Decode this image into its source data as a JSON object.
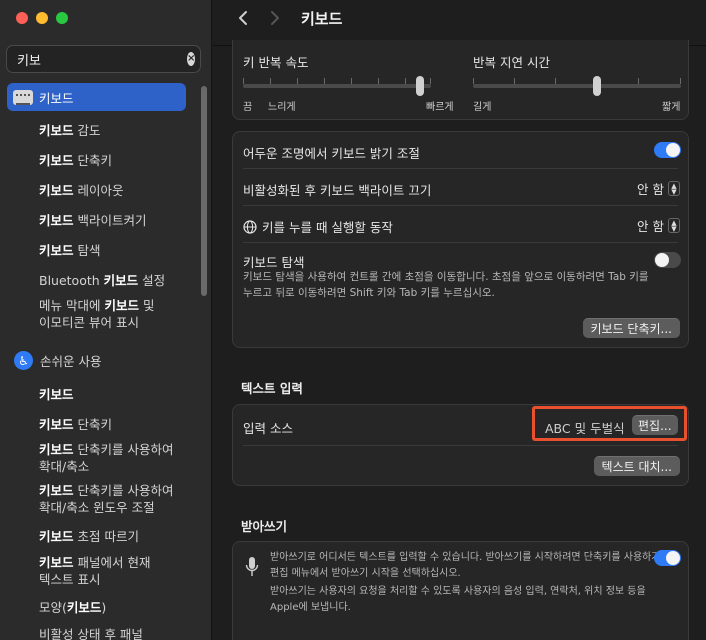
{
  "window": {
    "title": "키보드"
  },
  "search": {
    "value": "키보"
  },
  "sidebar": {
    "selected": "키보드",
    "items": [
      {
        "pre": "",
        "bold": "키보드",
        "post": " 감도"
      },
      {
        "pre": "",
        "bold": "키보드",
        "post": " 단축키"
      },
      {
        "pre": "",
        "bold": "키보드",
        "post": " 레이아웃"
      },
      {
        "pre": "",
        "bold": "키보드",
        "post": " 백라이트켜기"
      },
      {
        "pre": "",
        "bold": "키보드",
        "post": " 탐색"
      },
      {
        "pre": "Bluetooth ",
        "bold": "키보드",
        "post": " 설정"
      },
      {
        "pre": "메뉴 막대에 ",
        "bold": "키보드",
        "post": " 및"
      }
    ],
    "menu_line2": "이모티콘 뷰어 표시",
    "accessibility": {
      "header": "손쉬운 사용",
      "items": [
        {
          "bold": "키보드",
          "post": ""
        },
        {
          "bold": "키보드",
          "post": " 단축키"
        },
        {
          "bold": "키보드",
          "post": " 단축키를 사용하여",
          "line2": "확대/축소"
        },
        {
          "bold": "키보드",
          "post": " 단축키를 사용하여",
          "line2": "확대/축소 윈도우 조절"
        },
        {
          "bold": "키보드",
          "post": " 초점 따르기"
        },
        {
          "bold": "키보드",
          "post": " 패널에서 현재",
          "line2": "텍스트 표시"
        },
        {
          "pre": "모양(",
          "bold": "키보드",
          "post": ")"
        },
        {
          "pre": "비활성 상태 후 패널",
          "bold": "",
          "post": ""
        }
      ]
    }
  },
  "repeat": {
    "speed_label": "키 반복 속도",
    "speed_min": "끔",
    "speed_slow": "느리게",
    "speed_fast": "빠르게",
    "speed_value": 0.92,
    "delay_label": "반복 지연 시간",
    "delay_long": "길게",
    "delay_short": "짧게",
    "delay_value": 0.6
  },
  "backlight": {
    "adjust_label": "어두운 조명에서 키보드 밝기 조절",
    "adjust_on": true,
    "off_label": "비활성화된 후 키보드 백라이트 끄기",
    "off_value": "안 함",
    "globe_label": "키를 누를 때 실행할 동작",
    "globe_value": "안 함",
    "nav_label": "키보드 탐색",
    "nav_desc_1": "키보드 탐색을 사용하여 컨트롤 간에 초점을 이동합니다. 초점을 앞으로 이동하려면 Tab 키를",
    "nav_desc_2": "누르고 뒤로 이동하려면 Shift 키와 Tab 키를 누르십시오.",
    "nav_on": false,
    "shortcuts_button": "키보드 단축키..."
  },
  "text_input": {
    "section": "텍스트 입력",
    "source_label": "입력 소스",
    "source_value": "ABC 및 두벌식",
    "edit_button": "편집...",
    "replace_button": "텍스트 대치..."
  },
  "dictation": {
    "section": "받아쓰기",
    "desc_1": "받아쓰기로 어디서든 텍스트를 입력할 수 있습니다. 받아쓰기를 시작하려면 단축키를 사용하거나",
    "desc_2": "편집 메뉴에서 받아쓰기 시작을 선택하십시오.",
    "desc_3": "받아쓰기는 사용자의 요청을 처리할 수 있도록 사용자의 음성 입력, 연락처, 위치 정보 등을",
    "desc_4": "Apple에 보냅니다.",
    "on": true
  },
  "colors": {
    "accent": "#2f7bf6",
    "selection": "#2e62c9",
    "highlight": "#e9502d"
  }
}
